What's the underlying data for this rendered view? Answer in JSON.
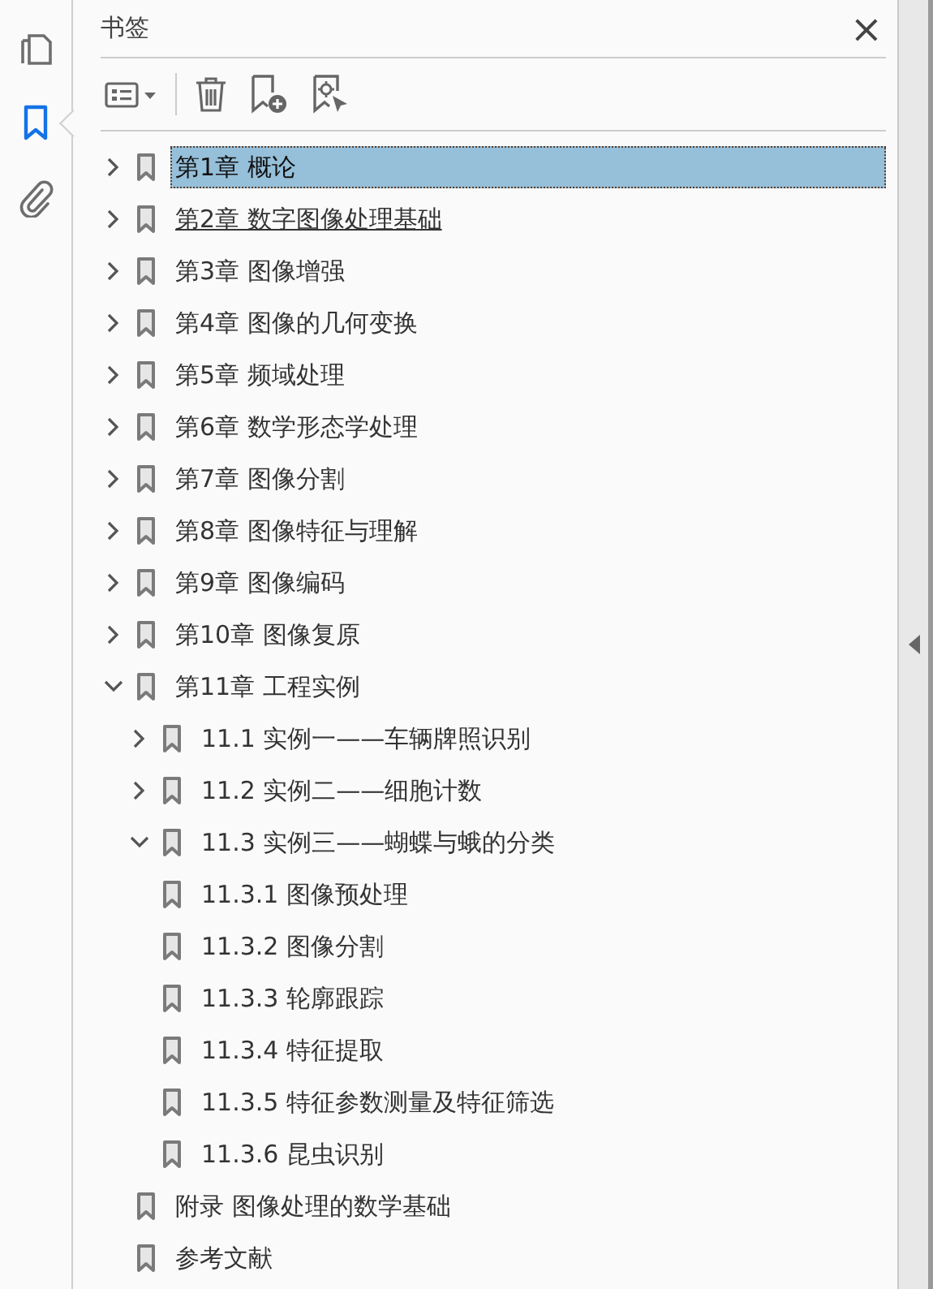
{
  "rail": [
    {
      "kind": "pages",
      "selected": false
    },
    {
      "kind": "bookmarks",
      "selected": true
    },
    {
      "kind": "attachments",
      "selected": false
    }
  ],
  "panel": {
    "title": "书签",
    "close": "×"
  },
  "bookmarks": [
    {
      "label": "第1章 概论",
      "expanded": false,
      "selected": true,
      "hovered": false
    },
    {
      "label": "第2章 数字图像处理基础",
      "expanded": false,
      "selected": false,
      "hovered": true
    },
    {
      "label": "第3章 图像增强",
      "expanded": false,
      "selected": false,
      "hovered": false
    },
    {
      "label": "第4章 图像的几何变换",
      "expanded": false,
      "selected": false,
      "hovered": false
    },
    {
      "label": "第5章 频域处理",
      "expanded": false,
      "selected": false,
      "hovered": false
    },
    {
      "label": "第6章 数学形态学处理",
      "expanded": false,
      "selected": false,
      "hovered": false
    },
    {
      "label": "第7章 图像分割",
      "expanded": false,
      "selected": false,
      "hovered": false
    },
    {
      "label": "第8章 图像特征与理解",
      "expanded": false,
      "selected": false,
      "hovered": false
    },
    {
      "label": "第9章 图像编码",
      "expanded": false,
      "selected": false,
      "hovered": false
    },
    {
      "label": "第10章 图像复原",
      "expanded": false,
      "selected": false,
      "hovered": false
    },
    {
      "label": "第11章 工程实例",
      "expanded": true,
      "selected": false,
      "hovered": false,
      "children": [
        {
          "label": "11.1 实例一——车辆牌照识别",
          "expanded": false,
          "selected": false,
          "hovered": false
        },
        {
          "label": "11.2 实例二——细胞计数",
          "expanded": false,
          "selected": false,
          "hovered": false
        },
        {
          "label": "11.3 实例三——蝴蝶与蛾的分类",
          "expanded": true,
          "selected": false,
          "hovered": false,
          "children": [
            {
              "label": "11.3.1 图像预处理",
              "selected": false,
              "hovered": false
            },
            {
              "label": "11.3.2 图像分割",
              "selected": false,
              "hovered": false
            },
            {
              "label": "11.3.3 轮廓跟踪",
              "selected": false,
              "hovered": false
            },
            {
              "label": "11.3.4 特征提取",
              "selected": false,
              "hovered": false
            },
            {
              "label": "11.3.5 特征参数测量及特征筛选",
              "selected": false,
              "hovered": false
            },
            {
              "label": "11.3.6 昆虫识别",
              "selected": false,
              "hovered": false
            }
          ]
        }
      ]
    },
    {
      "label": "附录 图像处理的数学基础",
      "selected": false,
      "hovered": false
    },
    {
      "label": "参考文献",
      "selected": false,
      "hovered": false
    }
  ]
}
